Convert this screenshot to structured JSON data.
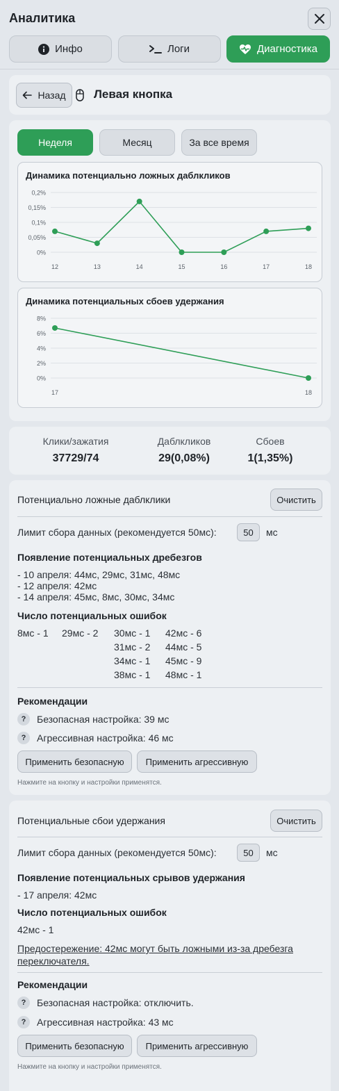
{
  "header": {
    "title": "Аналитика",
    "tabs": [
      {
        "label": "Инфо",
        "icon": "info-icon"
      },
      {
        "label": "Логи",
        "icon": "terminal-icon"
      },
      {
        "label": "Диагностика",
        "icon": "heart-pulse-icon"
      }
    ],
    "active_tab": "Диагностика"
  },
  "nav": {
    "back_label": "Назад",
    "page_title": "Левая кнопка",
    "page_icon": "mouse-icon"
  },
  "periods": {
    "items": [
      "Неделя",
      "Месяц",
      "За все время"
    ],
    "active": "Неделя"
  },
  "colors": {
    "accent": "#2e9e57",
    "background": "#e3e7ec",
    "card": "#edf0f3"
  },
  "chart_data": [
    {
      "type": "line",
      "title": "Динамика потенциально ложных даблкликов",
      "x": [
        "12",
        "13",
        "14",
        "15",
        "16",
        "17",
        "18"
      ],
      "values": [
        0.07,
        0.03,
        0.17,
        0.0,
        0.0,
        0.07,
        0.08
      ],
      "ylim": [
        0,
        0.2
      ],
      "yticks": [
        "0%",
        "0,05%",
        "0,1%",
        "0,15%",
        "0,2%"
      ],
      "grid": true,
      "color": "#2e9e57"
    },
    {
      "type": "line",
      "title": "Динамика потенциальных сбоев удержания",
      "x": [
        "17",
        "18"
      ],
      "values": [
        6.7,
        0.0
      ],
      "ylim": [
        0,
        8
      ],
      "yticks": [
        "0%",
        "2%",
        "4%",
        "6%",
        "8%"
      ],
      "grid": true,
      "color": "#2e9e57"
    }
  ],
  "stats": [
    {
      "label": "Клики/зажатия",
      "value": "37729/74"
    },
    {
      "label": "Даблкликов",
      "value": "29(0,08%)"
    },
    {
      "label": "Сбоев",
      "value": "1(1,35%)"
    }
  ],
  "double_clicks": {
    "title": "Потенциально ложные даблклики",
    "clear_label": "Очистить",
    "limit_label": "Лимит сбора данных (рекомендуется 50мс):",
    "limit_value": "50",
    "limit_unit": "мс",
    "bounce_heading": "Появление потенциальных дребезгов",
    "bounce_lines": [
      "- 10 апреля: 44мс, 29мс, 31мс, 48мс",
      "- 12 апреля: 42мс",
      "- 14 апреля: 45мс, 8мс, 30мс, 34мс"
    ],
    "errors_heading": "Число потенциальных ошибок",
    "errors": [
      [
        "8мс - 1",
        "29мс - 2",
        "30мс - 1",
        "42мс - 6"
      ],
      [
        "",
        "",
        "31мс - 2",
        "44мс - 5"
      ],
      [
        "",
        "",
        "34мс - 1",
        "45мс - 9"
      ],
      [
        "",
        "",
        "38мс - 1",
        "48мс - 1"
      ]
    ],
    "rec_heading": "Рекомендации",
    "rec_safe": "Безопасная настройка: 39 мс",
    "rec_aggressive": "Агрессивная настройка: 46 мс",
    "apply_safe_label": "Применить безопасную",
    "apply_aggressive_label": "Применить агрессивную",
    "hint": "Нажмите на кнопку и настройки применятся."
  },
  "hold_failures": {
    "title": "Потенциальные сбои удержания",
    "clear_label": "Очистить",
    "limit_label": "Лимит сбора данных (рекомендуется 50мс):",
    "limit_value": "50",
    "limit_unit": "мс",
    "breaks_heading": "Появление потенциальных срывов удержания",
    "breaks_lines": [
      "- 17 апреля: 42мс"
    ],
    "errors_heading": "Число потенциальных ошибок",
    "errors_line": "42мс - 1",
    "warning": "Предостережение: 42мс могут быть ложными из-за дребезга переключателя.",
    "rec_heading": "Рекомендации",
    "rec_safe": "Безопасная настройка: отключить.",
    "rec_aggressive": "Агрессивная настройка: 43 мс",
    "apply_safe_label": "Применить безопасную",
    "apply_aggressive_label": "Применить агрессивную",
    "hint": "Нажмите на кнопку и настройки применятся."
  }
}
